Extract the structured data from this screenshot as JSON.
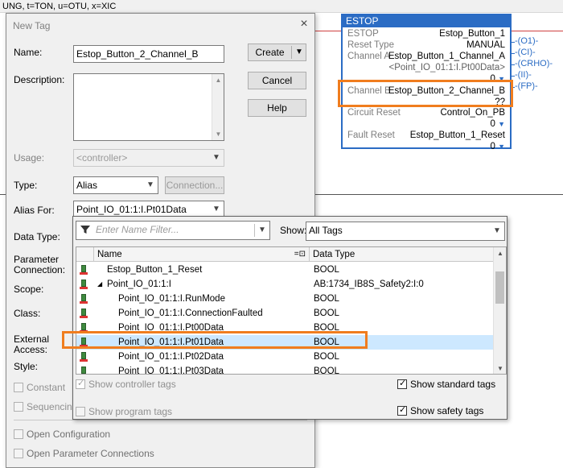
{
  "background": {
    "rung_caption": "UNG, t=TON, u=OTU, x=XIC"
  },
  "estop_block": {
    "title": "ESTOP",
    "rows": [
      {
        "label": "ESTOP",
        "value": "Estop_Button_1"
      },
      {
        "label": "Reset Type",
        "value": "MANUAL"
      },
      {
        "label": "Channel A",
        "value": "Estop_Button_1_Channel_A"
      },
      {
        "label": "Channel B",
        "value": "Estop_Button_2_Channel_B"
      },
      {
        "label": "Circuit Reset",
        "value": "Control_On_PB"
      },
      {
        "label": "Fault Reset",
        "value": "Estop_Button_1_Reset"
      }
    ],
    "channel_a_alias": "<Point_IO_01:1:I.Pt00Data>",
    "channel_a_value": "0",
    "channel_b_value": "??",
    "circuit_reset_value": "0",
    "fault_reset_value": "0",
    "pins": [
      "O1",
      "CI",
      "CRHO",
      "II",
      "FP"
    ]
  },
  "dialog": {
    "title": "New Tag",
    "close_symbol": "×",
    "labels": {
      "name": "Name:",
      "description": "Description:",
      "usage": "Usage:",
      "type": "Type:",
      "alias_for": "Alias For:",
      "data_type": "Data Type:",
      "parameter_connection_1": "Parameter",
      "parameter_connection_2": "Connection:",
      "scope": "Scope:",
      "class": "Class:",
      "external_access_1": "External",
      "external_access_2": "Access:",
      "style": "Style:"
    },
    "name_value": "Estop_Button_2_Channel_B",
    "usage_value": "<controller>",
    "type_value": "Alias",
    "alias_for_value": "Point_IO_01:1:I.Pt01Data",
    "buttons": {
      "create": "Create",
      "cancel": "Cancel",
      "help": "Help",
      "connection": "Connection..."
    },
    "checkboxes": {
      "constant": "Constant",
      "sequencing": "Sequencing",
      "open_configuration": "Open Configuration",
      "open_parameter_connections": "Open Parameter Connections"
    }
  },
  "tag_browser": {
    "filter_placeholder": "Enter Name Filter...",
    "show_label": "Show:",
    "show_value": "All Tags",
    "columns": [
      "Name",
      "Data Type"
    ],
    "rows": [
      {
        "name": "Estop_Button_1_Reset",
        "type": "BOOL",
        "indent": 0,
        "expander": "",
        "selected": false
      },
      {
        "name": "Point_IO_01:1:I",
        "type": "AB:1734_IB8S_Safety2:I:0",
        "indent": 0,
        "expander": "◢",
        "selected": false
      },
      {
        "name": "Point_IO_01:1:I.RunMode",
        "type": "BOOL",
        "indent": 1,
        "expander": "",
        "selected": false
      },
      {
        "name": "Point_IO_01:1:I.ConnectionFaulted",
        "type": "BOOL",
        "indent": 1,
        "expander": "",
        "selected": false
      },
      {
        "name": "Point_IO_01:1:I.Pt00Data",
        "type": "BOOL",
        "indent": 1,
        "expander": "",
        "selected": false
      },
      {
        "name": "Point_IO_01:1:I.Pt01Data",
        "type": "BOOL",
        "indent": 1,
        "expander": "",
        "selected": true
      },
      {
        "name": "Point_IO_01:1:I.Pt02Data",
        "type": "BOOL",
        "indent": 1,
        "expander": "",
        "selected": false
      },
      {
        "name": "Point_IO_01:1:I.Pt03Data",
        "type": "BOOL",
        "indent": 1,
        "expander": "",
        "selected": false
      }
    ],
    "checkboxes": {
      "show_controller_tags": "Show controller tags",
      "show_program_tags": "Show program tags",
      "show_standard_tags": "Show standard tags",
      "show_safety_tags": "Show safety tags"
    }
  },
  "colors": {
    "highlight_box": "#f07d1e",
    "estop_blue": "#2b6cc4",
    "selected_row": "#cde8ff"
  }
}
